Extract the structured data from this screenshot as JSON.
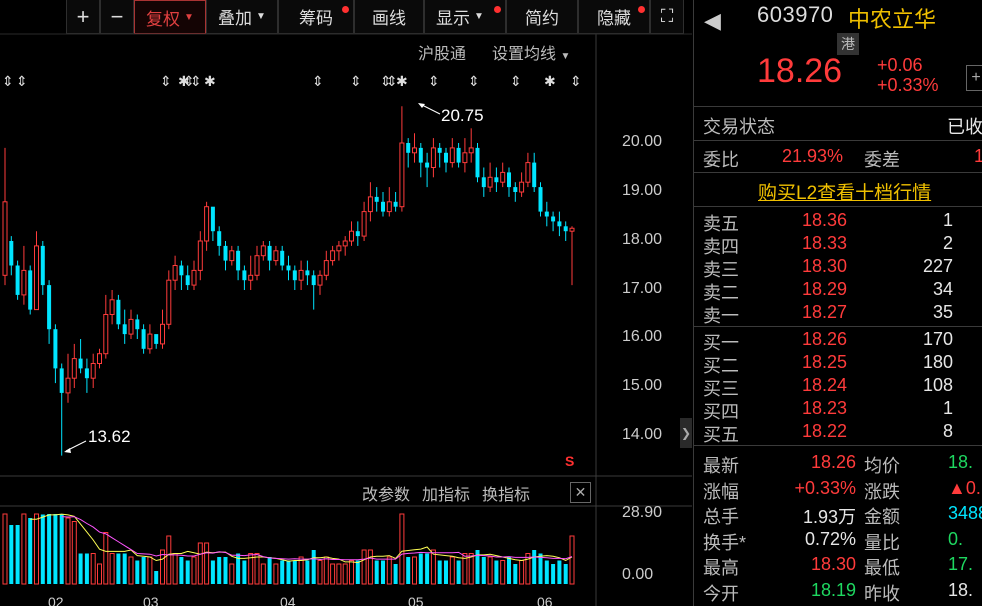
{
  "toolbar": {
    "zoom_in": "+",
    "zoom_out": "−",
    "fuquan": "复权",
    "diejia": "叠加",
    "chouma": "筹码",
    "huaxian": "画线",
    "xianshi": "显示",
    "jianyue": "简约",
    "yincang": "隐藏",
    "fullscreen_icon": "expand-icon"
  },
  "chart_header": {
    "hugutong": "沪股通",
    "set_ma": "设置均线"
  },
  "indicator_bar": {
    "modify_params": "改参数",
    "add_indicator": "加指标",
    "switch_indicator": "换指标"
  },
  "chart_data": {
    "type": "candlestick",
    "price_axis": [
      "20.00",
      "19.00",
      "18.00",
      "17.00",
      "16.00",
      "15.00",
      "14.00"
    ],
    "volume_axis": [
      "28.90",
      "0.00"
    ],
    "x_labels": [
      "02",
      "03",
      "04",
      "05",
      "06"
    ],
    "high_annotation": "20.75",
    "low_annotation": "13.62",
    "s_marker": "S",
    "up_color": "#ff3b3b",
    "down_color": "#00e5ff",
    "candles": [
      [
        17.3,
        18.8,
        17.1,
        19.9
      ],
      [
        18.0,
        17.5,
        17.3,
        18.1
      ],
      [
        17.5,
        16.9,
        16.8,
        17.6
      ],
      [
        16.9,
        17.4,
        16.7,
        17.9
      ],
      [
        17.4,
        16.6,
        16.5,
        17.5
      ],
      [
        16.6,
        17.9,
        16.6,
        18.2
      ],
      [
        17.9,
        17.1,
        16.9,
        18.0
      ],
      [
        17.1,
        16.2,
        15.9,
        17.2
      ],
      [
        16.2,
        15.4,
        15.1,
        16.3
      ],
      [
        15.4,
        14.9,
        13.62,
        15.5
      ],
      [
        14.9,
        15.2,
        14.7,
        15.7
      ],
      [
        15.2,
        15.6,
        15.0,
        15.9
      ],
      [
        15.6,
        15.4,
        15.3,
        16.0
      ],
      [
        15.4,
        15.2,
        14.9,
        15.6
      ],
      [
        15.2,
        15.5,
        15.0,
        15.7
      ],
      [
        15.5,
        15.7,
        15.4,
        15.8
      ],
      [
        15.7,
        16.5,
        15.6,
        16.9
      ],
      [
        16.5,
        16.8,
        16.3,
        17.0
      ],
      [
        16.8,
        16.3,
        16.2,
        16.9
      ],
      [
        16.3,
        16.1,
        15.9,
        16.6
      ],
      [
        16.1,
        16.4,
        16.0,
        16.6
      ],
      [
        16.4,
        16.2,
        16.0,
        16.5
      ],
      [
        16.2,
        15.8,
        15.7,
        16.3
      ],
      [
        15.8,
        16.1,
        15.7,
        16.3
      ],
      [
        16.1,
        15.9,
        15.8,
        16.0
      ],
      [
        15.9,
        16.3,
        15.8,
        16.6
      ],
      [
        16.3,
        17.2,
        16.2,
        17.4
      ],
      [
        17.2,
        17.5,
        17.0,
        17.7
      ],
      [
        17.5,
        17.3,
        17.0,
        17.6
      ],
      [
        17.3,
        17.1,
        17.0,
        17.5
      ],
      [
        17.1,
        17.4,
        17.0,
        17.6
      ],
      [
        17.4,
        18.0,
        17.2,
        18.2
      ],
      [
        18.0,
        18.7,
        17.8,
        18.8
      ],
      [
        18.7,
        18.2,
        18.0,
        18.5
      ],
      [
        18.2,
        17.9,
        17.7,
        18.3
      ],
      [
        17.9,
        17.6,
        17.4,
        18.0
      ],
      [
        17.6,
        17.8,
        17.5,
        17.9
      ],
      [
        17.8,
        17.4,
        17.2,
        17.9
      ],
      [
        17.4,
        17.2,
        17.0,
        17.5
      ],
      [
        17.2,
        17.3,
        17.0,
        17.7
      ],
      [
        17.3,
        17.7,
        17.2,
        17.9
      ],
      [
        17.7,
        17.9,
        17.6,
        18.0
      ],
      [
        17.9,
        17.6,
        17.4,
        18.0
      ],
      [
        17.6,
        17.8,
        17.5,
        17.9
      ],
      [
        17.8,
        17.5,
        17.4,
        17.9
      ],
      [
        17.5,
        17.4,
        17.2,
        17.7
      ],
      [
        17.4,
        17.2,
        17.0,
        17.5
      ],
      [
        17.2,
        17.4,
        17.0,
        17.6
      ],
      [
        17.4,
        17.3,
        17.1,
        17.6
      ],
      [
        17.3,
        17.1,
        16.6,
        17.4
      ],
      [
        17.1,
        17.3,
        16.9,
        17.4
      ],
      [
        17.3,
        17.6,
        17.2,
        17.8
      ],
      [
        17.6,
        17.8,
        17.5,
        17.9
      ],
      [
        17.8,
        17.9,
        17.6,
        18.0
      ],
      [
        17.9,
        18.0,
        17.7,
        18.1
      ],
      [
        18.0,
        18.2,
        17.9,
        18.4
      ],
      [
        18.2,
        18.1,
        17.9,
        18.4
      ],
      [
        18.1,
        18.6,
        18.0,
        18.8
      ],
      [
        18.6,
        18.9,
        18.4,
        19.2
      ],
      [
        18.9,
        18.8,
        18.6,
        19.1
      ],
      [
        18.8,
        18.6,
        18.5,
        19.0
      ],
      [
        18.6,
        18.8,
        18.5,
        19.1
      ],
      [
        18.8,
        18.7,
        18.6,
        19.0
      ],
      [
        18.7,
        20.0,
        18.6,
        20.75
      ],
      [
        20.0,
        19.8,
        19.5,
        20.1
      ],
      [
        19.8,
        19.9,
        19.6,
        20.2
      ],
      [
        19.9,
        19.6,
        19.3,
        20.0
      ],
      [
        19.6,
        19.5,
        19.1,
        19.8
      ],
      [
        19.5,
        19.9,
        19.3,
        20.1
      ],
      [
        19.9,
        19.8,
        19.5,
        20.0
      ],
      [
        19.8,
        19.6,
        19.4,
        19.9
      ],
      [
        19.6,
        19.9,
        19.5,
        20.1
      ],
      [
        19.9,
        19.6,
        19.5,
        20.0
      ],
      [
        19.6,
        19.8,
        19.4,
        20.1
      ],
      [
        19.8,
        19.9,
        19.6,
        20.3
      ],
      [
        19.9,
        19.3,
        19.2,
        20.0
      ],
      [
        19.3,
        19.1,
        18.9,
        19.5
      ],
      [
        19.1,
        19.3,
        19.0,
        19.6
      ],
      [
        19.3,
        19.2,
        19.0,
        19.5
      ],
      [
        19.2,
        19.4,
        19.1,
        19.6
      ],
      [
        19.4,
        19.1,
        18.9,
        19.5
      ],
      [
        19.1,
        19.0,
        18.8,
        19.2
      ],
      [
        19.0,
        19.2,
        18.9,
        19.4
      ],
      [
        19.2,
        19.6,
        19.1,
        19.8
      ],
      [
        19.6,
        19.1,
        19.0,
        19.8
      ],
      [
        19.1,
        18.6,
        18.5,
        19.2
      ],
      [
        18.6,
        18.5,
        18.3,
        18.8
      ],
      [
        18.5,
        18.4,
        18.2,
        18.6
      ],
      [
        18.4,
        18.3,
        18.1,
        18.6
      ],
      [
        18.3,
        18.2,
        18.0,
        18.4
      ],
      [
        18.2,
        18.26,
        17.1,
        18.3
      ]
    ]
  },
  "stock": {
    "back_icon": "back-arrow-icon",
    "code": "603970",
    "name": "中农立华",
    "badge": "港",
    "price": "18.26",
    "change": "+0.06",
    "change_pct": "+0.33%",
    "plus_btn": "+",
    "status_label": "交易状态",
    "status_value": "已收",
    "weibi_label": "委比",
    "weibi_value": "21.93%",
    "weicha_label": "委差",
    "weicha_value": "1",
    "l2_link": "购买L2查看十档行情"
  },
  "orderbook": {
    "asks": [
      {
        "label": "卖五",
        "price": "18.36",
        "vol": "1"
      },
      {
        "label": "卖四",
        "price": "18.33",
        "vol": "2"
      },
      {
        "label": "卖三",
        "price": "18.30",
        "vol": "227"
      },
      {
        "label": "卖二",
        "price": "18.29",
        "vol": "34"
      },
      {
        "label": "卖一",
        "price": "18.27",
        "vol": "35"
      }
    ],
    "bids": [
      {
        "label": "买一",
        "price": "18.26",
        "vol": "170"
      },
      {
        "label": "买二",
        "price": "18.25",
        "vol": "180"
      },
      {
        "label": "买三",
        "price": "18.24",
        "vol": "108"
      },
      {
        "label": "买四",
        "price": "18.23",
        "vol": "1"
      },
      {
        "label": "买五",
        "price": "18.22",
        "vol": "8"
      }
    ]
  },
  "stats": [
    {
      "l1": "最新",
      "v1": "18.26",
      "c1": "red",
      "l2": "均价",
      "v2": "18.",
      "c2": "green"
    },
    {
      "l1": "涨幅",
      "v1": "+0.33%",
      "c1": "red",
      "l2": "涨跌",
      "v2": "▲0.",
      "c2": "red"
    },
    {
      "l1": "总手",
      "v1": "1.93万",
      "c1": "white",
      "l2": "金额",
      "v2": "3488",
      "c2": "cyan"
    },
    {
      "l1": "换手*",
      "v1": "0.72%",
      "c1": "white",
      "l2": "量比",
      "v2": "0.",
      "c2": "green"
    },
    {
      "l1": "最高",
      "v1": "18.30",
      "c1": "red",
      "l2": "最低",
      "v2": "17.",
      "c2": "green"
    },
    {
      "l1": "今开",
      "v1": "18.19",
      "c1": "green",
      "l2": "昨收",
      "v2": "18.",
      "c2": "white"
    }
  ]
}
